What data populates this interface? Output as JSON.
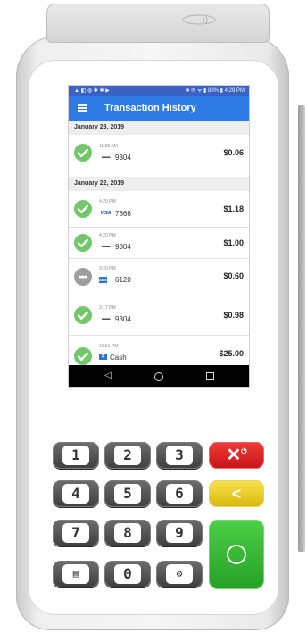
{
  "status_bar": {
    "left_icons": "▲ ◧ ◍ ✱ ✱ ▶",
    "right_text": "✱ ✉ ᯤ ▮ 88% ▮ 4:28 PM"
  },
  "app_bar": {
    "menu_icon": "hamburger-menu-icon",
    "title": "Transaction History"
  },
  "transactions": {
    "group1": {
      "date": "January 23, 2019",
      "items": [
        {
          "time": "11:58 AM",
          "brand": "▬▬",
          "last4": "9304",
          "amount": "$0.06",
          "status": "approved"
        }
      ]
    },
    "group2": {
      "date": "January 22, 2019",
      "items": [
        {
          "time": "4:29 PM",
          "brand": "VISA",
          "last4": "7866",
          "amount": "$1.18",
          "status": "approved"
        },
        {
          "time": "4:20 PM",
          "brand": "▬▬",
          "last4": "9304",
          "amount": "$1.00",
          "status": "approved"
        },
        {
          "time": "3:20 PM",
          "brand": "AMEX",
          "last4": "6120",
          "amount": "$0.60",
          "status": "voided"
        },
        {
          "time": "3:17 PM",
          "brand": "▬▬",
          "last4": "9304",
          "amount": "$0.98",
          "status": "approved"
        },
        {
          "time": "12:51 PM",
          "brand": "$",
          "last4": "Cash",
          "amount": "$25.00",
          "status": "approved"
        }
      ]
    }
  },
  "nav_bar": {
    "back": "◁"
  },
  "keypad": {
    "k1": "1",
    "k2": "2",
    "k3": "3",
    "k4": "4",
    "k5": "5",
    "k6": "6",
    "k7": "7",
    "k8": "8",
    "k9": "9",
    "k0": "0",
    "menu_key": "▤",
    "settings_key": "⚙",
    "cancel": "✕",
    "power": "⏻",
    "clear": "<"
  },
  "colors": {
    "app_bar": "#2f7be5",
    "approved": "#73c66b",
    "voided": "#9e9e9e",
    "cancel_key": "#e32525",
    "clear_key": "#f0d12c",
    "enter_key": "#3bbb38"
  }
}
